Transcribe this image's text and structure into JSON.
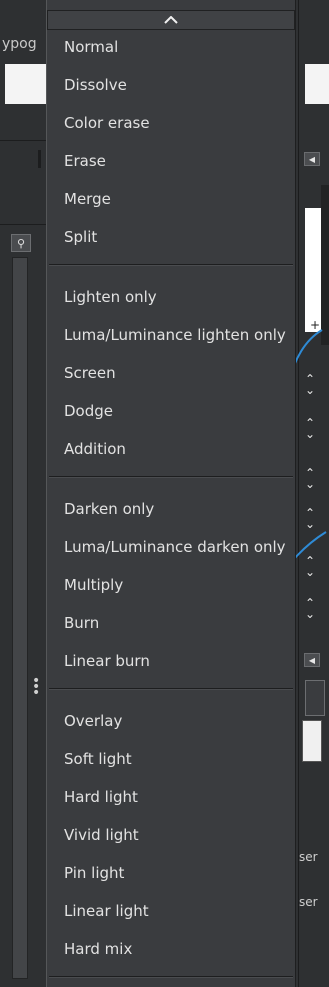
{
  "background": {
    "left_fragment_text": "ypog",
    "right_fragment_text_1": "ser",
    "right_fragment_text_2": "ser"
  },
  "menu": {
    "scroll_up_icon": "chevron-up-icon",
    "groups": [
      [
        "Normal",
        "Dissolve",
        "Color erase",
        "Erase",
        "Merge",
        "Split"
      ],
      [
        "Lighten only",
        "Luma/Luminance lighten only",
        "Screen",
        "Dodge",
        "Addition"
      ],
      [
        "Darken only",
        "Luma/Luminance darken only",
        "Multiply",
        "Burn",
        "Linear burn"
      ],
      [
        "Overlay",
        "Soft light",
        "Hard light",
        "Vivid light",
        "Pin light",
        "Linear light",
        "Hard mix"
      ]
    ]
  },
  "colors": {
    "menu_bg": "#3a3c3f",
    "text": "#e2e2e2",
    "curve_blue": "#2e8bd6"
  }
}
